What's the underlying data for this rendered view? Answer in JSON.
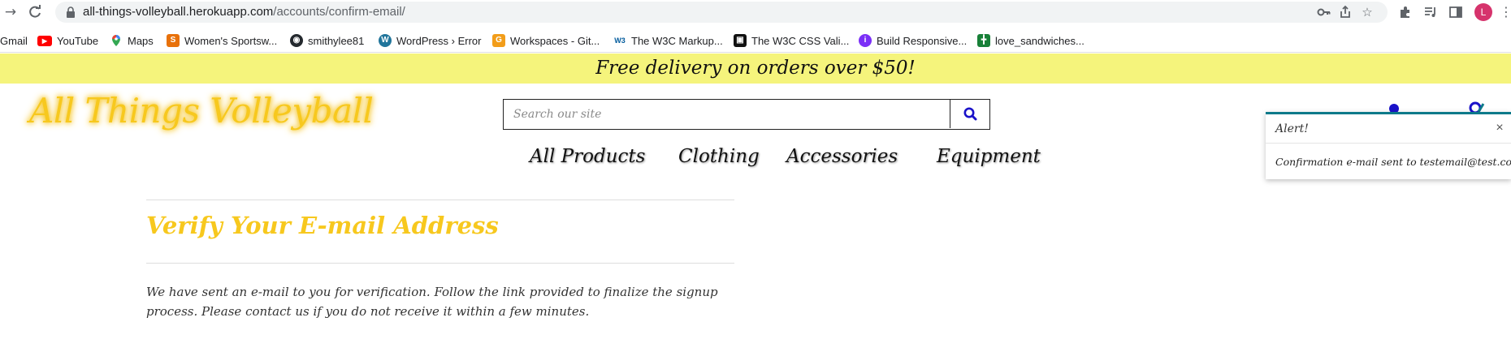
{
  "browser": {
    "url_host": "all-things-volleyball.herokuapp.com",
    "url_path": "/accounts/confirm-email/",
    "profile_initial": "L",
    "bookmarks": [
      {
        "label": "Gmail",
        "icon": "gmail-icon"
      },
      {
        "label": "YouTube",
        "icon": "youtube-icon",
        "color": "#ff0000"
      },
      {
        "label": "Maps",
        "icon": "maps-icon"
      },
      {
        "label": "Women's Sportsw...",
        "icon": "sportswear-icon",
        "color": "#e8710a"
      },
      {
        "label": "smithylee81",
        "icon": "github-icon",
        "color": "#24292e"
      },
      {
        "label": "WordPress › Error",
        "icon": "wordpress-icon",
        "color": "#21759b"
      },
      {
        "label": "Workspaces - Git...",
        "icon": "gitpod-icon",
        "color": "#f29d1a"
      },
      {
        "label": "The W3C Markup...",
        "icon": "w3c-icon",
        "color": "#005a9c"
      },
      {
        "label": "The W3C CSS Vali...",
        "icon": "w3c-css-icon",
        "color": "#111111"
      },
      {
        "label": "Build Responsive...",
        "icon": "build-responsive-icon",
        "color": "#7b2ff7"
      },
      {
        "label": "love_sandwiches...",
        "icon": "sheets-icon",
        "color": "#188038"
      }
    ]
  },
  "site": {
    "banner": "Free delivery on orders over $50!",
    "logo": "All Things Volleyball",
    "search_placeholder": "Search our site",
    "nav": [
      "All Products",
      "Clothing",
      "Accessories",
      "Equipment"
    ],
    "heading": "Verify Your E-mail Address",
    "body": "We have sent an e-mail to you for verification. Follow the link provided to finalize the signup process. Please contact us if you do not receive it within a few minutes."
  },
  "toast": {
    "title": "Alert!",
    "close": "×",
    "message": "Confirmation e-mail sent to testemail@test.com."
  },
  "colors": {
    "banner_bg": "#f5f47c",
    "brand_yellow": "#f7c81e",
    "toast_accent": "#0d7a8a",
    "search_icon": "#1a12c9"
  }
}
